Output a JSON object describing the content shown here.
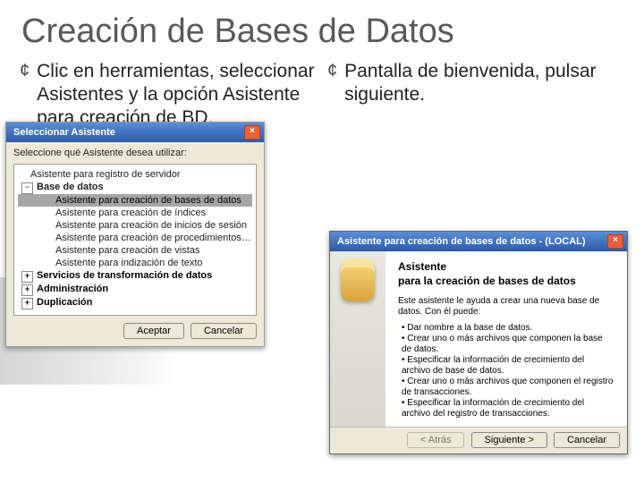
{
  "title": "Creación de Bases de Datos",
  "bullets": {
    "left": "Clic en herramientas, seleccionar Asistentes y la opción Asistente para creación de BD.",
    "right": "Pantalla de bienvenida, pulsar siguiente."
  },
  "dialog_left": {
    "title": "Seleccionar Asistente",
    "instruction": "Seleccione qué Asistente desea utilizar:",
    "tree": {
      "top_item": "Asistente para registro de servidor",
      "open_node": "Base de datos",
      "option_selected": "Asistente para creación de bases de datos",
      "options": [
        "Asistente para creación de índices",
        "Asistente para creación de inicios de sesión",
        "Asistente para creación de procedimientos almacenados",
        "Asistente para creación de vistas",
        "Asistente para indización de texto"
      ],
      "closed_nodes": [
        "Servicios de transformación de datos",
        "Administración",
        "Duplicación"
      ]
    },
    "buttons": {
      "ok": "Aceptar",
      "cancel": "Cancelar"
    }
  },
  "dialog_right": {
    "title": "Asistente para creación de bases de datos - (LOCAL)",
    "heading": "Asistente",
    "subheading": "para la creación de bases de datos",
    "description": "Este asistente le ayuda a crear una nueva base de datos. Con él puede:",
    "items": [
      "Dar nombre a la base de datos.",
      "Crear uno o más archivos que componen la base de datos.",
      "Especificar la información de crecimiento del archivo de base de datos.",
      "Crear uno o más archivos que componen el registro de transacciones.",
      "Especificar la información de crecimiento del archivo del registro de transacciones."
    ],
    "buttons": {
      "back": "< Atrás",
      "next": "Siguiente >",
      "cancel": "Cancelar"
    }
  }
}
